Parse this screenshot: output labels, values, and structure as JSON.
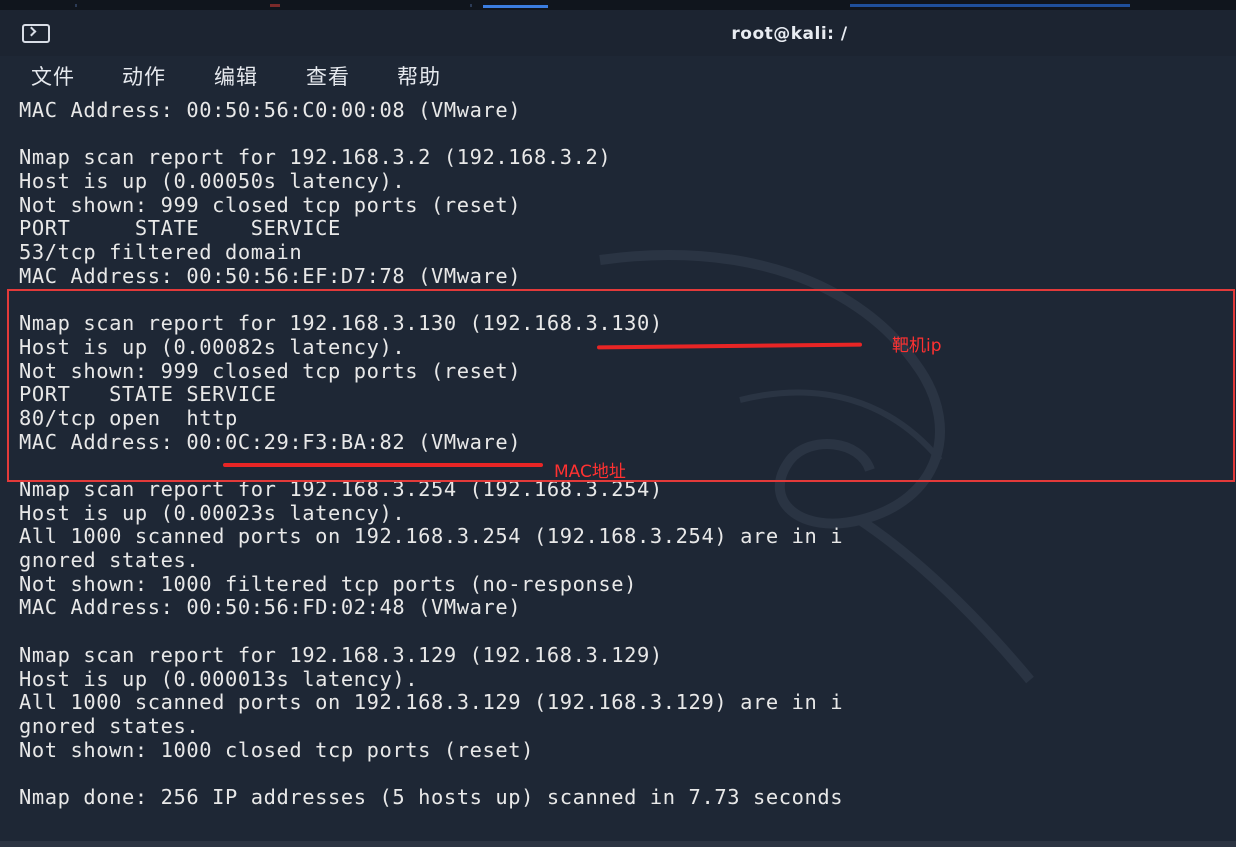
{
  "window": {
    "title": "root@kali: /"
  },
  "menu": [
    "文件",
    "动作",
    "编辑",
    "查看",
    "帮助"
  ],
  "terminal_lines": [
    "MAC Address: 00:50:56:C0:00:08 (VMware)",
    "",
    "Nmap scan report for 192.168.3.2 (192.168.3.2)",
    "Host is up (0.00050s latency).",
    "Not shown: 999 closed tcp ports (reset)",
    "PORT     STATE    SERVICE",
    "53/tcp filtered domain",
    "MAC Address: 00:50:56:EF:D7:78 (VMware)",
    "",
    "Nmap scan report for 192.168.3.130 (192.168.3.130)",
    "Host is up (0.00082s latency).",
    "Not shown: 999 closed tcp ports (reset)",
    "PORT   STATE SERVICE",
    "80/tcp open  http",
    "MAC Address: 00:0C:29:F3:BA:82 (VMware)",
    "",
    "Nmap scan report for 192.168.3.254 (192.168.3.254)",
    "Host is up (0.00023s latency).",
    "All 1000 scanned ports on 192.168.3.254 (192.168.3.254) are in i",
    "gnored states.",
    "Not shown: 1000 filtered tcp ports (no-response)",
    "MAC Address: 00:50:56:FD:02:48 (VMware)",
    "",
    "Nmap scan report for 192.168.3.129 (192.168.3.129)",
    "Host is up (0.000013s latency).",
    "All 1000 scanned ports on 192.168.3.129 (192.168.3.129) are in i",
    "gnored states.",
    "Not shown: 1000 closed tcp ports (reset)",
    "",
    "Nmap done: 256 IP addresses (5 hosts up) scanned in 7.73 seconds"
  ],
  "annotations": {
    "target_ip_label": "靶机ip",
    "mac_label": "MAC地址"
  },
  "colors": {
    "annotation": "#e82525",
    "terminal_bg": "#1e2735",
    "terminal_fg": "#e8e8e8"
  },
  "icons": {
    "window_icon": "terminal-icon"
  }
}
